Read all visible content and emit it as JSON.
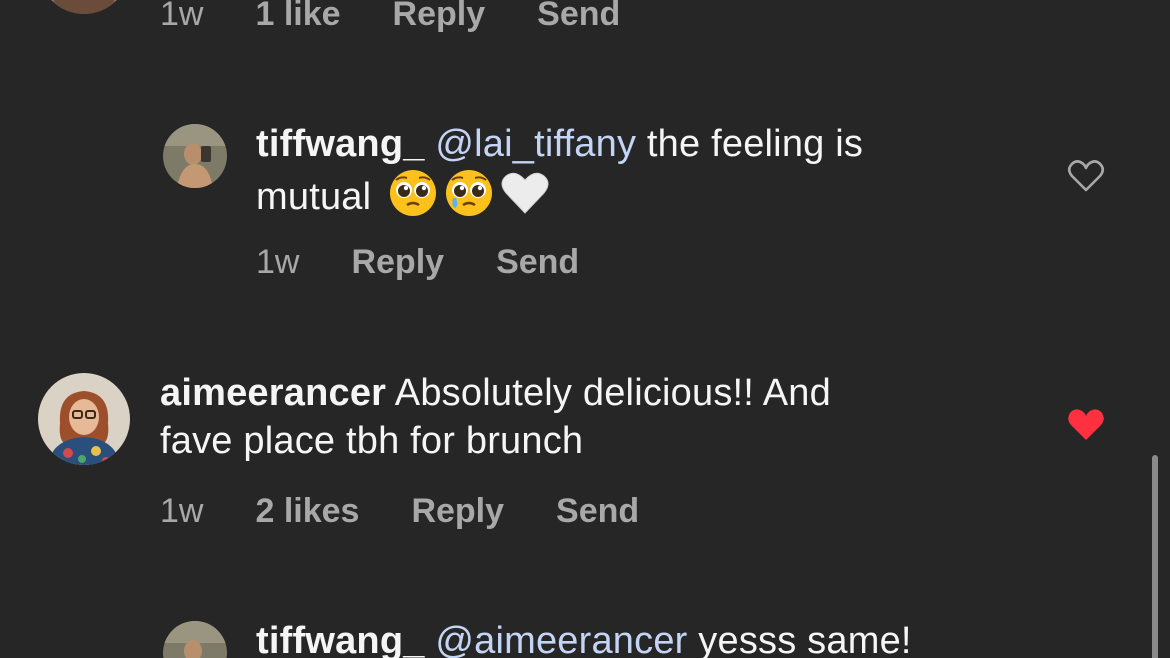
{
  "comments": [
    {
      "meta": {
        "time": "1w",
        "likes": "1 like",
        "reply": "Reply",
        "send": "Send"
      }
    },
    {
      "username": "tiffwang_",
      "mention": "@lai_tiffany",
      "text": " the feeling is",
      "text_line2": "mutual",
      "emojis": [
        "pleading-face",
        "pleading-face",
        "white-heart"
      ],
      "meta": {
        "time": "1w",
        "reply": "Reply",
        "send": "Send"
      },
      "liked": false
    },
    {
      "username": "aimeerancer",
      "text": " Absolutely delicious!! And",
      "text_line2": "fave place tbh for brunch",
      "meta": {
        "time": "1w",
        "likes": "2 likes",
        "reply": "Reply",
        "send": "Send"
      },
      "liked": true
    },
    {
      "username": "tiffwang_",
      "mention": "@aimeerancer",
      "text": " yesss same!"
    }
  ],
  "colors": {
    "background": "#262626",
    "text": "#f5f5f5",
    "secondary": "#a8a8a8",
    "mention": "#c4d4f5",
    "liked_heart": "#ff3040"
  }
}
